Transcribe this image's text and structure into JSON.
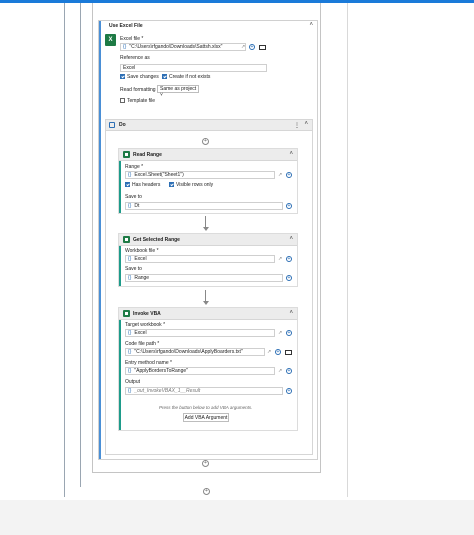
{
  "scope": {
    "title": "Use Excel File",
    "excel_file_label": "Excel file *",
    "excel_file_value": "\"C:\\Users\\rfgando\\Downloads\\Sattsh.xlsx\"",
    "reference_as_label": "Reference as",
    "reference_as_value": "Excel",
    "save_changes_label": "Save changes",
    "create_if_not_exists_label": "Create if not exists",
    "read_formatting_label": "Read formatting",
    "read_formatting_value": "Same as project",
    "template_file_label": "Template file"
  },
  "do_block": {
    "title": "Do"
  },
  "read_range": {
    "title": "Read Range",
    "range_label": "Range *",
    "range_value": "Excel.Sheet(\"Sheet1\")",
    "has_headers_label": "Has headers",
    "visible_rows_label": "Visible rows only",
    "save_to_label": "Save to",
    "save_to_value": "Dt"
  },
  "get_selected_range": {
    "title": "Get Selected Range",
    "workbook_label": "Workbook file *",
    "workbook_value": "Excel",
    "save_to_label": "Save to",
    "save_to_value": "Range"
  },
  "invoke_vba": {
    "title": "Invoke VBA",
    "target_label": "Target workbook *",
    "target_value": "Excel",
    "code_path_label": "Code file path *",
    "code_path_value": "\"C:\\Users\\rfgando\\Downloads\\ApplyBoarders.txt\"",
    "entry_label": "Entry method name *",
    "entry_value": "\"ApplyBordersToRange\"",
    "output_label": "Output",
    "output_value": "_out_InvokeVBAX_1__Result",
    "hint": "Press the button below to add VBA arguments.",
    "add_arg_button": "Add VBA Argument"
  },
  "icons": {
    "expression": "{}",
    "plus": "+",
    "expand": "↗",
    "collapse": "˄",
    "more": "⋮"
  }
}
